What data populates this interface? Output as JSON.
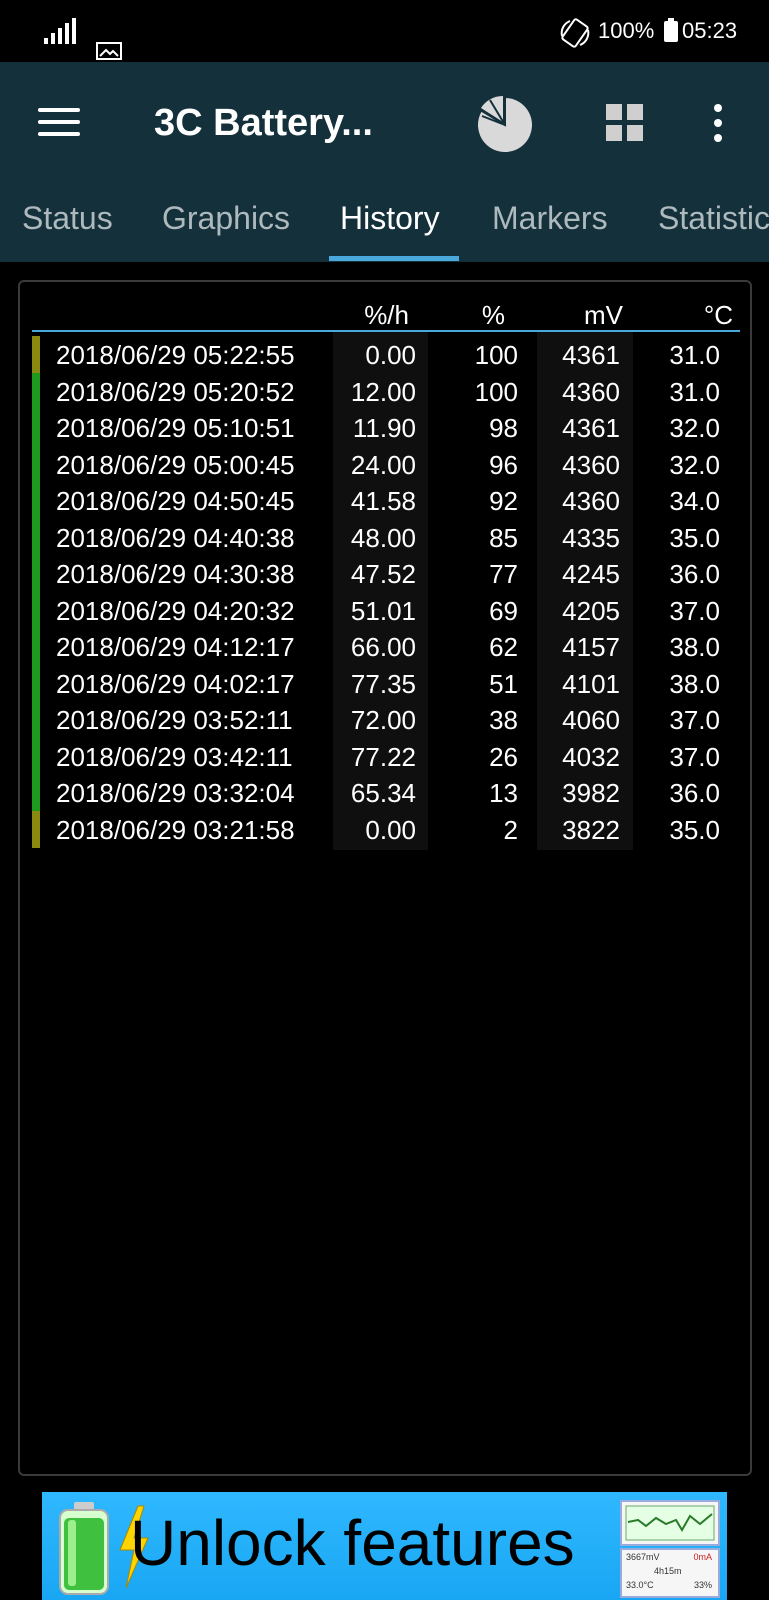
{
  "status_bar": {
    "battery_percent": "100%",
    "time": "05:23",
    "icons": [
      "signal-icon",
      "image-notification-icon",
      "auto-rotate-icon",
      "battery-icon"
    ]
  },
  "app_bar": {
    "title": "3C Battery...",
    "icons": [
      "menu-icon",
      "pie-chart-icon",
      "grid-icon",
      "more-options-icon"
    ]
  },
  "tabs": [
    {
      "label": "Status",
      "active": false
    },
    {
      "label": "Graphics",
      "active": false
    },
    {
      "label": "History",
      "active": true
    },
    {
      "label": "Markers",
      "active": false
    },
    {
      "label": "Statistic",
      "active": false
    }
  ],
  "table": {
    "headers": {
      "rate": "%/h",
      "pct": "%",
      "mv": "mV",
      "temp": "°C"
    },
    "rows": [
      {
        "datetime": "2018/06/29  05:22:55",
        "rate": "0.00",
        "pct": "100",
        "mv": "4361",
        "temp": "31.0",
        "marker": "olive"
      },
      {
        "datetime": "2018/06/29  05:20:52",
        "rate": "12.00",
        "pct": "100",
        "mv": "4360",
        "temp": "31.0",
        "marker": "green"
      },
      {
        "datetime": "2018/06/29  05:10:51",
        "rate": "11.90",
        "pct": "98",
        "mv": "4361",
        "temp": "32.0",
        "marker": "green"
      },
      {
        "datetime": "2018/06/29  05:00:45",
        "rate": "24.00",
        "pct": "96",
        "mv": "4360",
        "temp": "32.0",
        "marker": "green"
      },
      {
        "datetime": "2018/06/29  04:50:45",
        "rate": "41.58",
        "pct": "92",
        "mv": "4360",
        "temp": "34.0",
        "marker": "green"
      },
      {
        "datetime": "2018/06/29  04:40:38",
        "rate": "48.00",
        "pct": "85",
        "mv": "4335",
        "temp": "35.0",
        "marker": "green"
      },
      {
        "datetime": "2018/06/29  04:30:38",
        "rate": "47.52",
        "pct": "77",
        "mv": "4245",
        "temp": "36.0",
        "marker": "green"
      },
      {
        "datetime": "2018/06/29  04:20:32",
        "rate": "51.01",
        "pct": "69",
        "mv": "4205",
        "temp": "37.0",
        "marker": "green"
      },
      {
        "datetime": "2018/06/29  04:12:17",
        "rate": "66.00",
        "pct": "62",
        "mv": "4157",
        "temp": "38.0",
        "marker": "green"
      },
      {
        "datetime": "2018/06/29  04:02:17",
        "rate": "77.35",
        "pct": "51",
        "mv": "4101",
        "temp": "38.0",
        "marker": "green"
      },
      {
        "datetime": "2018/06/29  03:52:11",
        "rate": "72.00",
        "pct": "38",
        "mv": "4060",
        "temp": "37.0",
        "marker": "green"
      },
      {
        "datetime": "2018/06/29  03:42:11",
        "rate": "77.22",
        "pct": "26",
        "mv": "4032",
        "temp": "37.0",
        "marker": "green"
      },
      {
        "datetime": "2018/06/29  03:32:04",
        "rate": "65.34",
        "pct": "13",
        "mv": "3982",
        "temp": "36.0",
        "marker": "green"
      },
      {
        "datetime": "2018/06/29  03:21:58",
        "rate": "0.00",
        "pct": "2",
        "mv": "3822",
        "temp": "35.0",
        "marker": "olive"
      }
    ]
  },
  "ad": {
    "text": "Unlock features",
    "thumb_line1": "3667mV",
    "thumb_line2": "0mA",
    "thumb_line3": "4h15m",
    "thumb_line4": "33.0°C",
    "thumb_line5": "33%"
  },
  "colors": {
    "app_bar": "#13303b",
    "tab_indicator": "#4aa8dd",
    "marker_green": "#1e9b1e",
    "marker_olive": "#8a8a10",
    "ad_background": "#2fb8ff"
  }
}
